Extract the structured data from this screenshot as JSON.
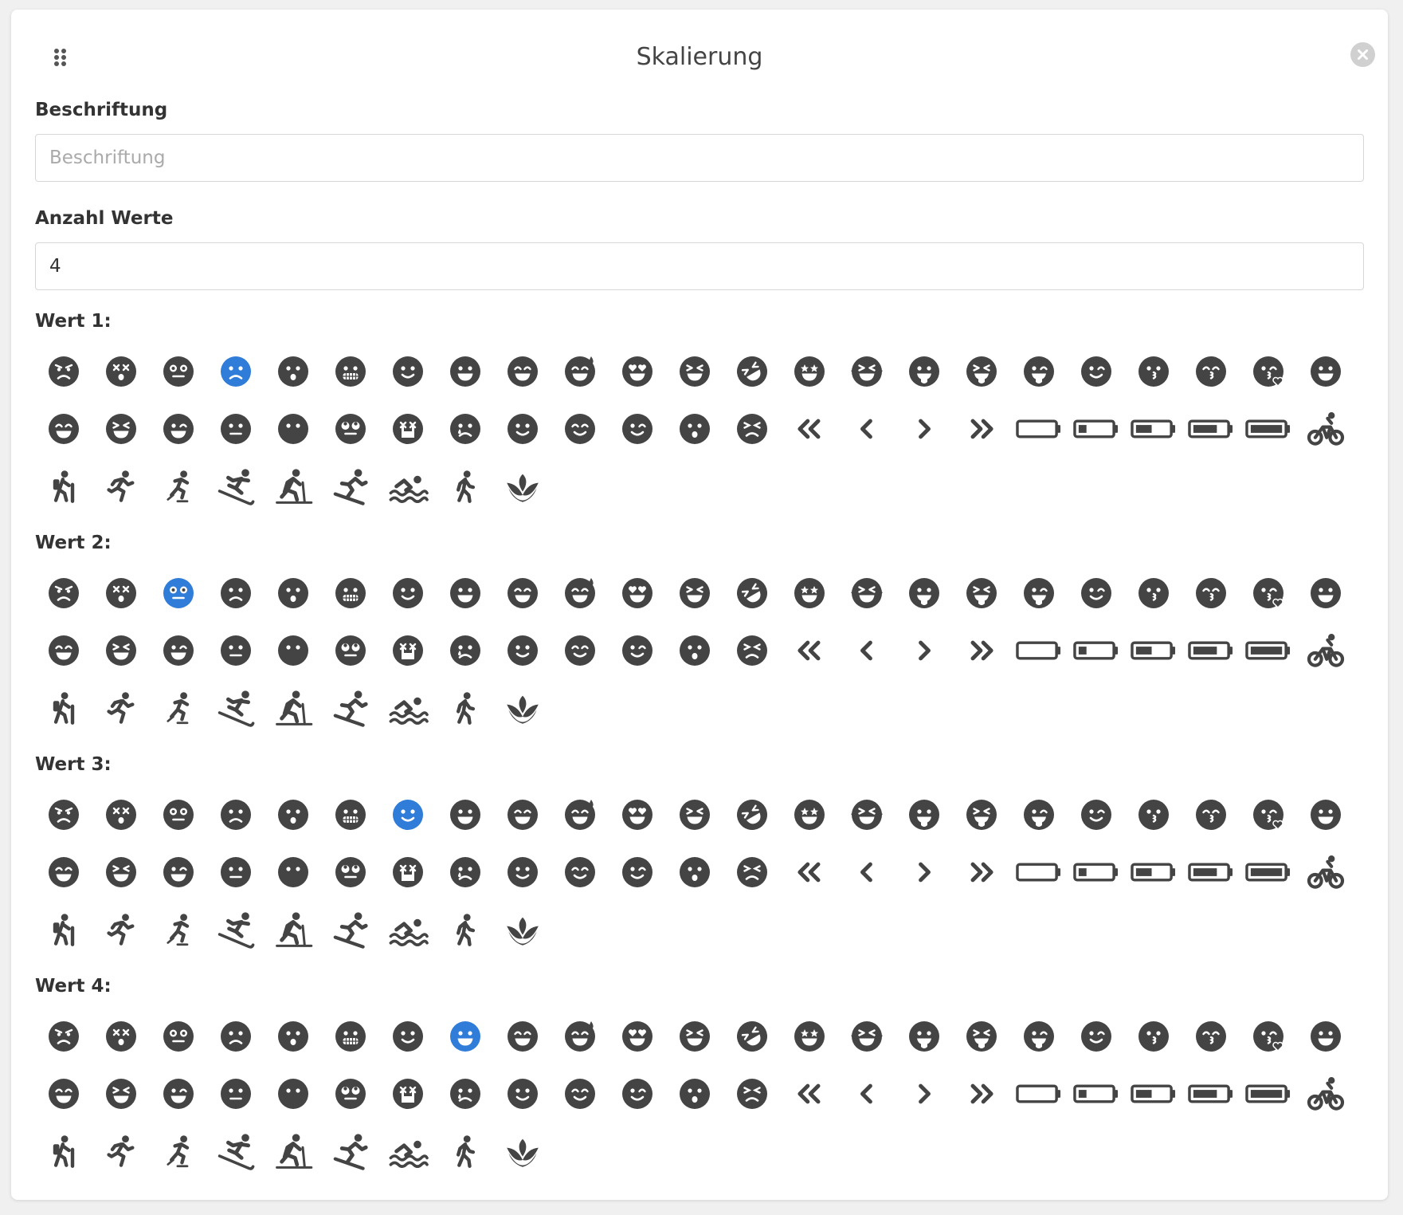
{
  "dialog": {
    "title": "Skalierung"
  },
  "form": {
    "caption_label": "Beschriftung",
    "caption_placeholder": "Beschriftung",
    "caption_value": "",
    "count_label": "Anzahl Werte",
    "count_value": "4"
  },
  "colors": {
    "icon": "#444444",
    "selected": "#2f7cd9",
    "close_bg": "#d0d0d0"
  },
  "icons": [
    "face-angry-icon",
    "face-dizzy-icon",
    "face-flushed-icon",
    "face-frown-icon",
    "face-frown-open-icon",
    "face-grimace-icon",
    "face-smile-icon",
    "face-grin-icon",
    "face-grin-beam-icon",
    "face-grin-beam-sweat-icon",
    "face-grin-hearts-icon",
    "face-grin-squint-icon",
    "face-rolling-laughing-icon",
    "face-grin-stars-icon",
    "face-laugh-tears-icon",
    "face-grin-tongue-icon",
    "face-grin-tongue-squint-icon",
    "face-grin-tongue-wink-icon",
    "face-grin-wink-icon",
    "face-kiss-icon",
    "face-kiss-beam-icon",
    "face-kiss-wink-heart-icon",
    "face-laugh-icon",
    "face-laugh-beam-icon",
    "face-laugh-squint-icon",
    "face-laugh-wink-icon",
    "face-meh-icon",
    "face-meh-blank-icon",
    "face-rolling-eyes-icon",
    "face-sad-cry-icon",
    "face-sad-tear-icon",
    "face-smile-simple-icon",
    "face-smile-beam-icon",
    "face-smile-wink-icon",
    "face-surprise-icon",
    "face-tired-icon",
    "angles-left-icon",
    "angle-left-icon",
    "angle-right-icon",
    "angles-right-icon",
    "battery-empty-icon",
    "battery-quarter-icon",
    "battery-half-icon",
    "battery-three-quarters-icon",
    "battery-full-icon",
    "bicycle-icon",
    "hiking-icon",
    "running-icon",
    "skating-icon",
    "skiing-icon",
    "skiing-nordic-icon",
    "snowboarding-icon",
    "swimming-icon",
    "walking-icon",
    "spa-icon"
  ],
  "scales": [
    {
      "label": "Wert 1:",
      "selected_index": 3
    },
    {
      "label": "Wert 2:",
      "selected_index": 2
    },
    {
      "label": "Wert 3:",
      "selected_index": 6
    },
    {
      "label": "Wert 4:",
      "selected_index": 7
    }
  ]
}
